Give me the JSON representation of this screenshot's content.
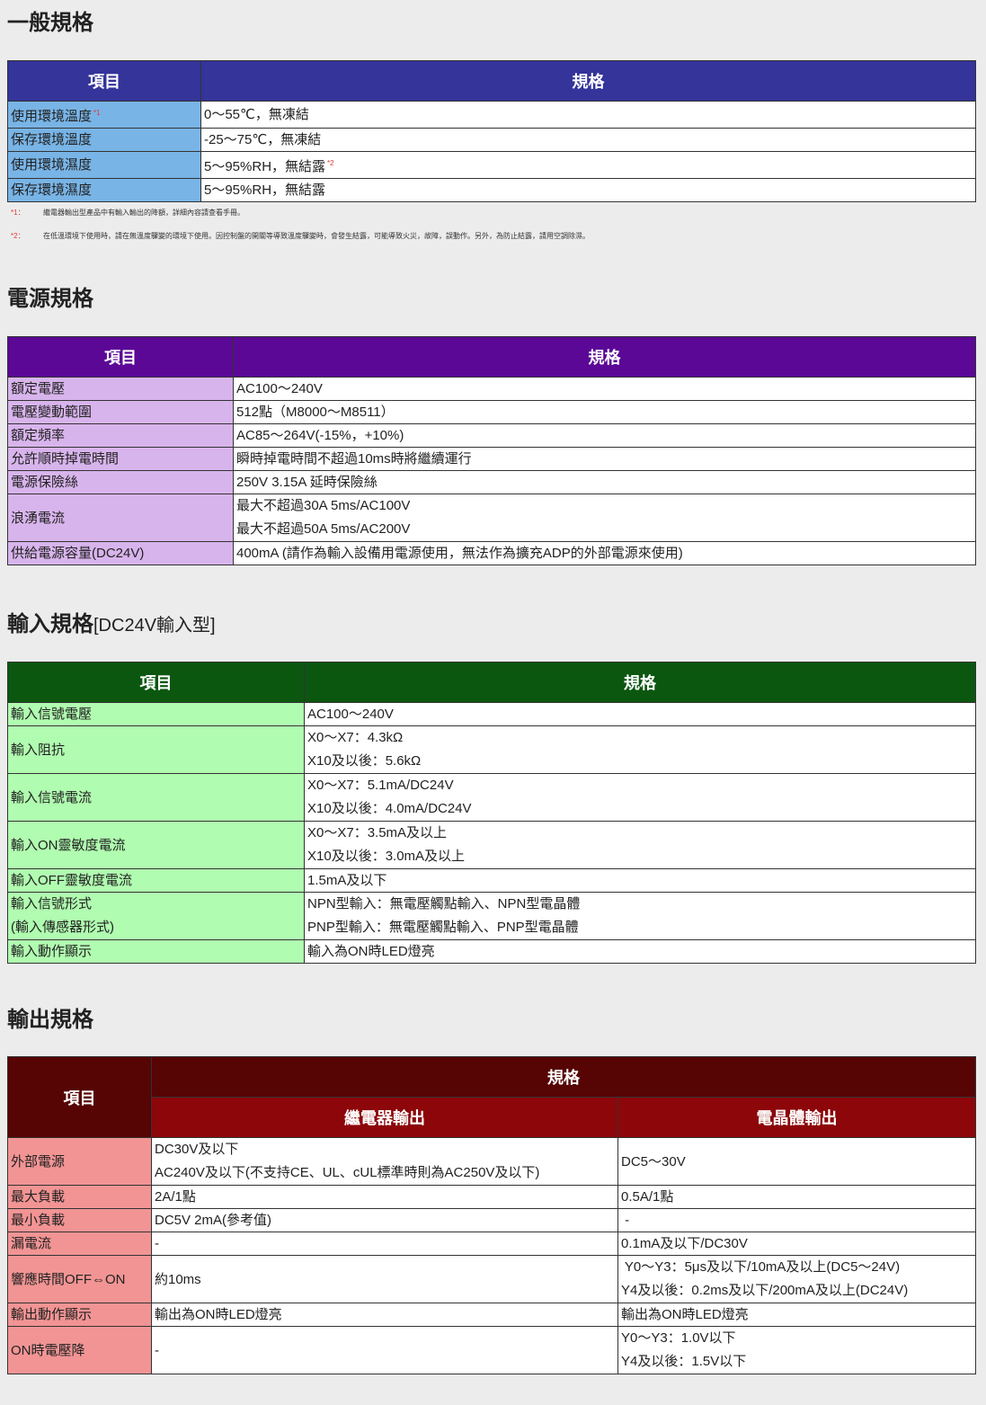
{
  "general": {
    "title": "一般規格",
    "headers": [
      "項目",
      "規格"
    ],
    "rows": [
      {
        "item": "使用環境溫度",
        "mark": "*1",
        "spec": "0～55℃，無凍結",
        "spec_mark": ""
      },
      {
        "item": "保存環境溫度",
        "mark": "",
        "spec": "-25～75℃，無凍結",
        "spec_mark": ""
      },
      {
        "item": "使用環境濕度",
        "mark": "",
        "spec": "5～95%RH，無結露",
        "spec_mark": "*2"
      },
      {
        "item": "保存環境濕度",
        "mark": "",
        "spec": "5～95%RH，無結露",
        "spec_mark": ""
      }
    ],
    "notes": [
      {
        "num": "*1：",
        "text": "繼電器輸出型產品中有輸入輸出的降額，詳細內容請查看手冊。"
      },
      {
        "num": "*2：",
        "text": "在低溫環境下使用時，請在無溫度驟變的環境下使用。因控制盤的開關等導致溫度驟變時，會發生結露，可能導致火災，故障，誤動作。另外，為防止結露，請用空調除濕。"
      }
    ]
  },
  "power": {
    "title": "電源規格",
    "headers": [
      "項目",
      "規格"
    ],
    "rows": [
      {
        "item": "額定電壓",
        "spec": [
          "AC100～240V"
        ]
      },
      {
        "item": "電壓變動範圍",
        "spec": [
          "512點（M8000～M8511）"
        ]
      },
      {
        "item": "額定頻率",
        "spec": [
          "AC85～264V(-15%，+10%)"
        ]
      },
      {
        "item": "允許順時掉電時間",
        "spec": [
          "瞬時掉電時間不超過10ms時將繼續運行"
        ]
      },
      {
        "item": "電源保險絲",
        "spec": [
          "250V 3.15A 延時保險絲"
        ]
      },
      {
        "item": "浪湧電流",
        "spec": [
          "最大不超過30A 5ms/AC100V",
          "最大不超過50A 5ms/AC200V"
        ]
      },
      {
        "item": "供給電源容量(DC24V)",
        "spec": [
          "400mA (請作為輸入設備用電源使用，無法作為擴充ADP的外部電源來使用)"
        ]
      }
    ]
  },
  "input": {
    "title": "輸入規格",
    "subtitle": "[DC24V輸入型]",
    "headers": [
      "項目",
      "規格"
    ],
    "rows": [
      {
        "item": [
          "輸入信號電壓"
        ],
        "spec": [
          "AC100～240V"
        ]
      },
      {
        "item": [
          "輸入阻抗"
        ],
        "spec": [
          "X0～X7：4.3kΩ",
          "X10及以後：5.6kΩ"
        ]
      },
      {
        "item": [
          "輸入信號電流"
        ],
        "spec": [
          "X0～X7：5.1mA/DC24V",
          "X10及以後：4.0mA/DC24V"
        ]
      },
      {
        "item": [
          "輸入ON靈敏度電流"
        ],
        "spec": [
          "X0～X7：3.5mA及以上",
          "X10及以後：3.0mA及以上"
        ]
      },
      {
        "item": [
          "輸入OFF靈敏度電流"
        ],
        "spec": [
          "1.5mA及以下"
        ]
      },
      {
        "item": [
          "輸入信號形式",
          "(輸入傳感器形式)"
        ],
        "spec": [
          "NPN型輸入：無電壓觸點輸入、NPN型電晶體",
          "PNP型輸入：無電壓觸點輸入、PNP型電晶體"
        ]
      },
      {
        "item": [
          "輸入動作顯示"
        ],
        "spec": [
          "輸入為ON時LED燈亮"
        ]
      }
    ]
  },
  "output": {
    "title": "輸出規格",
    "header_item": "項目",
    "header_spec": "規格",
    "header_relay": "繼電器輸出",
    "header_transistor": "電晶體輸出",
    "rows": [
      {
        "item": "外部電源",
        "relay": [
          "DC30V及以下",
          "AC240V及以下(不支持CE、UL、cUL標準時則為AC250V及以下)"
        ],
        "transistor": [
          "DC5～30V"
        ]
      },
      {
        "item": "最大負載",
        "relay": [
          "2A/1點"
        ],
        "transistor": [
          "0.5A/1點"
        ]
      },
      {
        "item": "最小負載",
        "relay": [
          "DC5V 2mA(參考值)"
        ],
        "transistor": [
          " -"
        ]
      },
      {
        "item": "漏電流",
        "relay": [
          "-"
        ],
        "transistor": [
          "0.1mA及以下/DC30V"
        ]
      },
      {
        "item": "響應時間OFF⇔ON",
        "relay": [
          "約10ms"
        ],
        "transistor": [
          " Y0～Y3：5μs及以下/10mA及以上(DC5～24V)",
          "Y4及以後：0.2ms及以下/200mA及以上(DC24V)"
        ]
      },
      {
        "item": "輸出動作顯示",
        "relay": [
          "輸出為ON時LED燈亮"
        ],
        "transistor": [
          "輸出為ON時LED燈亮"
        ]
      },
      {
        "item": "ON時電壓降",
        "relay": [
          "-"
        ],
        "transistor": [
          "Y0～Y3：1.0V以下",
          "Y4及以後：1.5V以下"
        ]
      }
    ]
  }
}
